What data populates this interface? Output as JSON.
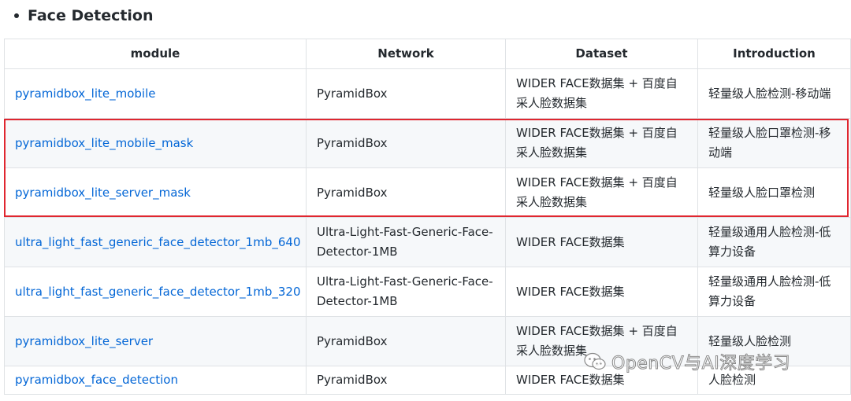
{
  "heading": {
    "title": "Face Detection"
  },
  "table": {
    "headers": [
      "module",
      "Network",
      "Dataset",
      "Introduction"
    ],
    "rows": [
      {
        "module": "pyramidbox_lite_mobile",
        "network": "PyramidBox",
        "dataset": "WIDER FACE数据集 + 百度自采人脸数据集",
        "intro": "轻量级人脸检测-移动端"
      },
      {
        "module": "pyramidbox_lite_mobile_mask",
        "network": "PyramidBox",
        "dataset": "WIDER FACE数据集 + 百度自采人脸数据集",
        "intro": "轻量级人脸口罩检测-移动端"
      },
      {
        "module": "pyramidbox_lite_server_mask",
        "network": "PyramidBox",
        "dataset": "WIDER FACE数据集 + 百度自采人脸数据集",
        "intro": "轻量级人脸口罩检测"
      },
      {
        "module": "ultra_light_fast_generic_face_detector_1mb_640",
        "network": "Ultra-Light-Fast-Generic-Face-Detector-1MB",
        "dataset": "WIDER FACE数据集",
        "intro": "轻量级通用人脸检测-低算力设备"
      },
      {
        "module": "ultra_light_fast_generic_face_detector_1mb_320",
        "network": "Ultra-Light-Fast-Generic-Face-Detector-1MB",
        "dataset": "WIDER FACE数据集",
        "intro": "轻量级通用人脸检测-低算力设备"
      },
      {
        "module": "pyramidbox_lite_server",
        "network": "PyramidBox",
        "dataset": "WIDER FACE数据集 + 百度自采人脸数据集",
        "intro": "轻量级人脸检测"
      },
      {
        "module": "pyramidbox_face_detection",
        "network": "PyramidBox",
        "dataset": "WIDER FACE数据集",
        "intro": "人脸检测"
      }
    ]
  },
  "watermark": {
    "text": "OpenCV与AI深度学习",
    "icon": "wechat-icon"
  },
  "colors": {
    "link": "#0366d6",
    "highlight_border": "#e0262f",
    "row_alt": "#f6f8fa",
    "border": "#dfe2e5"
  }
}
